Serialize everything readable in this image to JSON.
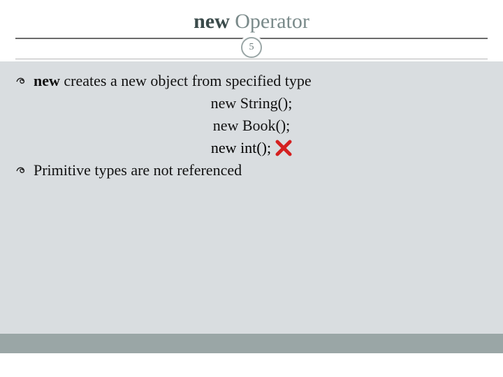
{
  "title": {
    "bold": "new",
    "rest": " Operator"
  },
  "page_number": "5",
  "lines": {
    "b1_bold": "new",
    "b1_rest": " creates a new object from specified type",
    "c1": "new String();",
    "c2": "new Book();",
    "c3": "new int();",
    "b2": "Primitive types are not referenced"
  },
  "icons": {
    "cross": "cross-icon"
  }
}
